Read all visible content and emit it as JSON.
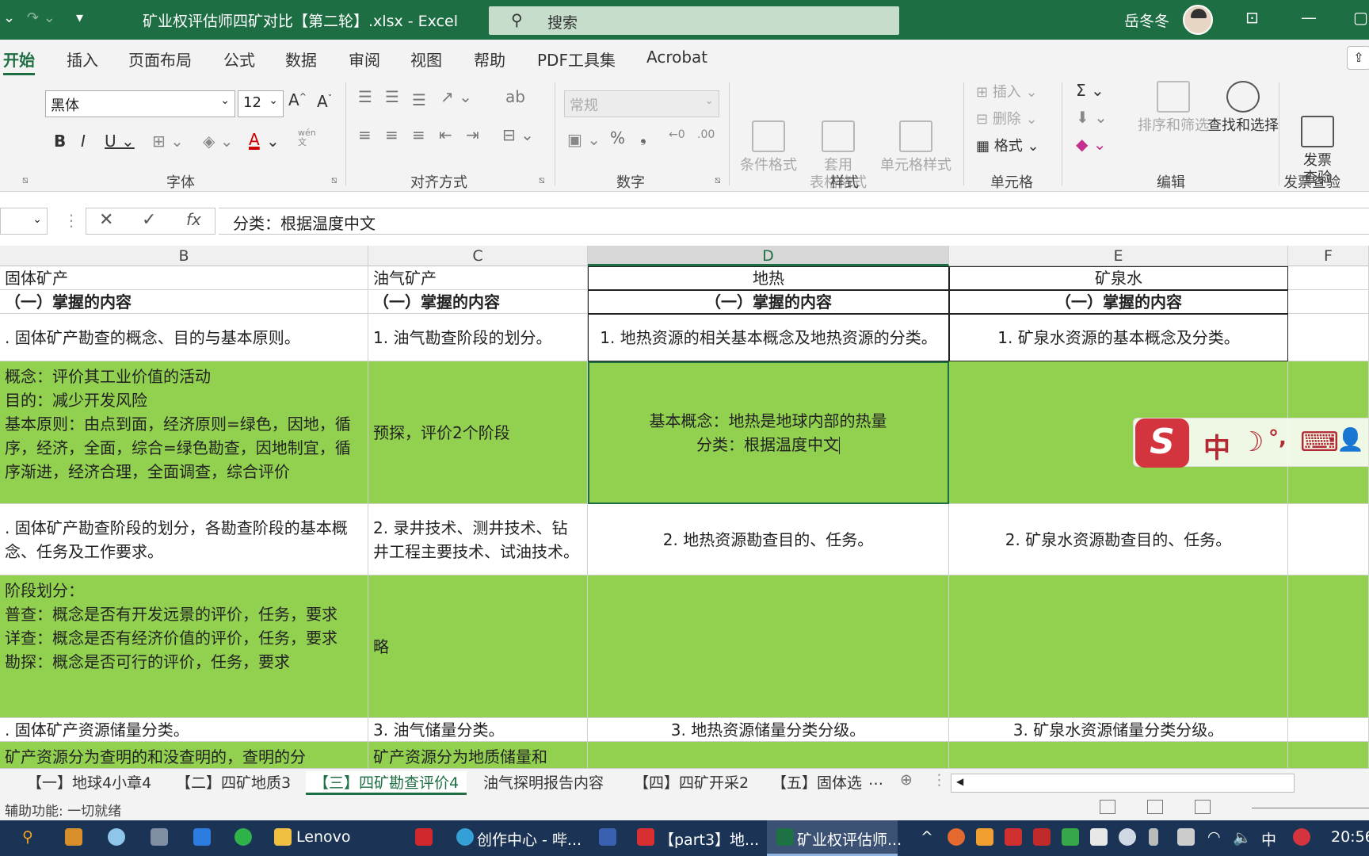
{
  "window": {
    "title": "矿业权评估师四矿对比【第二轮】.xlsx  -  Excel",
    "search_placeholder": "搜索",
    "user": "岳冬冬"
  },
  "ribbon_tabs": [
    "开始",
    "插入",
    "页面布局",
    "公式",
    "数据",
    "审阅",
    "视图",
    "帮助",
    "PDF工具集",
    "Acrobat"
  ],
  "ribbon": {
    "font_name": "黑体",
    "font_size": "12",
    "number_format": "常规",
    "groups": {
      "font": "字体",
      "align": "对齐方式",
      "number": "数字",
      "styles": "样式",
      "cells": "单元格",
      "edit": "编辑",
      "invoice": "发票查验"
    },
    "styles_buttons": {
      "cond": "条件格式",
      "table": "套用\n表格格式",
      "cell": "单元格样式"
    },
    "cells_buttons": {
      "insert": "插入",
      "delete": "删除",
      "format": "格式"
    },
    "edit_buttons": {
      "sort": "排序和筛选",
      "find": "查找和选择"
    },
    "invoice_button": "发票\n查验",
    "wen_label": "wén\n文"
  },
  "formula_bar": {
    "fx": "fx",
    "content": "分类：根据温度中文"
  },
  "columns": [
    "B",
    "C",
    "D",
    "E",
    "F"
  ],
  "rows": {
    "r1": {
      "B": "固体矿产",
      "C": "油气矿产",
      "D": "地热",
      "E": "矿泉水"
    },
    "r2": {
      "B": "（一）掌握的内容",
      "C": "（一）掌握的内容",
      "D": "（一）掌握的内容",
      "E": "（一）掌握的内容"
    },
    "r3": {
      "B": ". 固体矿产勘查的概念、目的与基本原则。",
      "C": "1. 油气勘查阶段的划分。",
      "D": "1. 地热资源的相关基本概念及地热资源的分类。",
      "E": "1. 矿泉水资源的基本概念及分类。"
    },
    "r4": {
      "B": "概念：评价其工业价值的活动\n目的：减少开发风险\n基本原则：由点到面，经济原则=绿色，因地，循序，经济，全面，综合=绿色勘查，因地制宜，循序渐进，经济合理，全面调查，综合评价",
      "C": "预探，评价2个阶段",
      "D1": "基本概念：地热是地球内部的热量",
      "D2": "分类：根据温度中文",
      "E": ""
    },
    "r5": {
      "B": ". 固体矿产勘查阶段的划分，各勘查阶段的基本概念、任务及工作要求。",
      "C": "2. 录井技术、测井技术、钻井工程主要技术、试油技术。",
      "D": "2. 地热资源勘查目的、任务。",
      "E": "2. 矿泉水资源勘查目的、任务。"
    },
    "r6": {
      "B": "阶段划分：\n普查：概念是否有开发远景的评价，任务，要求\n详查：概念是否有经济价值的评价，任务，要求\n勘探：概念是否可行的评价，任务，要求",
      "C": "略",
      "D": "",
      "E": ""
    },
    "r7": {
      "B": ". 固体矿产资源储量分类。",
      "C": "3. 油气储量分类。",
      "D": "3. 地热资源储量分类分级。",
      "E": "3. 矿泉水资源储量分类分级。"
    },
    "r8": {
      "B": "矿产资源分为查明的和没查明的，查明的分",
      "C": "矿产资源分为地质储量和",
      "D": "",
      "E": ""
    }
  },
  "sheet_tabs": [
    "【一】地球4小章4",
    "【二】四矿地质3",
    "【三】四矿勘查评价4",
    "油气探明报告内容",
    "【四】四矿开采2",
    "【五】固体选"
  ],
  "status": {
    "text": "辅助功能: 一切就绪"
  },
  "ime": {
    "labels": [
      "中",
      "☽",
      "°,",
      "⌨",
      "👤"
    ]
  },
  "taskbar": {
    "items": [
      "Lenovo",
      "创作中心 - 哔...",
      "【part3】地...",
      "矿业权评估师..."
    ],
    "tray_lang": "中",
    "clock": "20:56"
  },
  "colors": {
    "excel_green": "#1e6e43",
    "cell_green": "#92d050",
    "taskbar": "#1b3455"
  }
}
